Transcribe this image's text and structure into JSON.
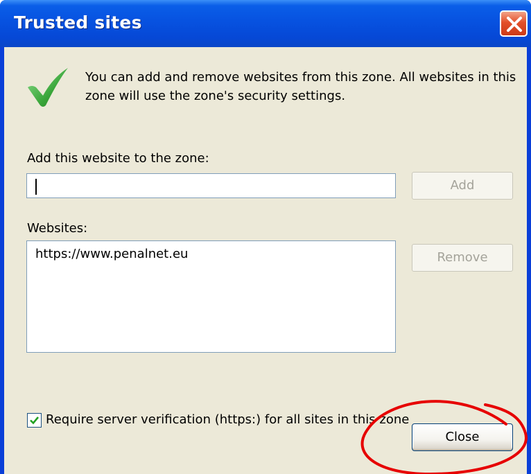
{
  "window": {
    "title": "Trusted sites"
  },
  "info_text": "You can add and remove websites from this zone. All websites in this zone will use the zone's security settings.",
  "add_section": {
    "label": "Add this website to the zone:",
    "input_value": "",
    "add_button": "Add"
  },
  "websites_section": {
    "label": "Websites:",
    "items": [
      "https://www.penalnet.eu"
    ],
    "remove_button": "Remove"
  },
  "verification": {
    "checked": true,
    "label": "Require server verification (https:) for all sites in this zone"
  },
  "close_button": "Close",
  "colors": {
    "title_bar": "#0752e0",
    "dialog_bg": "#ece9d8",
    "annotation_red": "#e60000",
    "check_green": "#3aa63a"
  }
}
